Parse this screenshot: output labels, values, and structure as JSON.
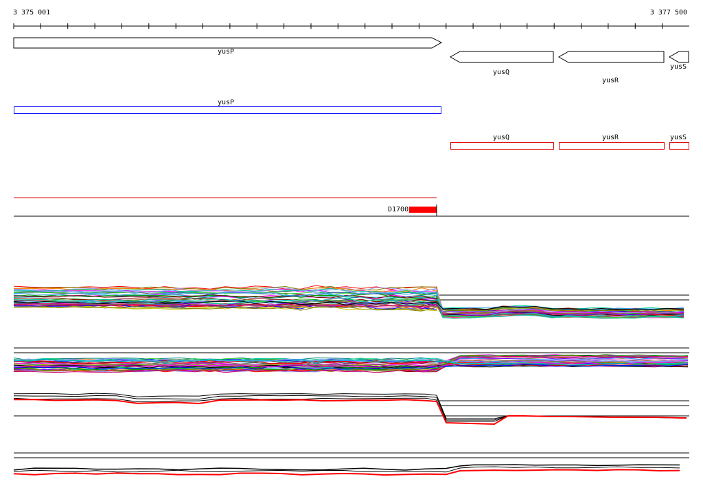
{
  "ruler": {
    "start_label": "3 375 001",
    "end_label": "3 377 500"
  },
  "annotated_genes": [
    {
      "name": "yusP",
      "strand": "+"
    },
    {
      "name": "yusQ",
      "strand": "-"
    },
    {
      "name": "yusR",
      "strand": "-"
    },
    {
      "name": "yusS",
      "strand": "-"
    }
  ],
  "blue_genes": [
    {
      "name": "yusP"
    }
  ],
  "red_genes": [
    {
      "name": "yusQ"
    },
    {
      "name": "yusR"
    },
    {
      "name": "yusS"
    }
  ],
  "segment": {
    "label": "D1700",
    "color": "#ff0000"
  },
  "colors": {
    "forward_gene_outline": "#000000",
    "blue_box": "#1010ff",
    "red_box": "#e00000",
    "red_trace": "#ff0000"
  }
}
